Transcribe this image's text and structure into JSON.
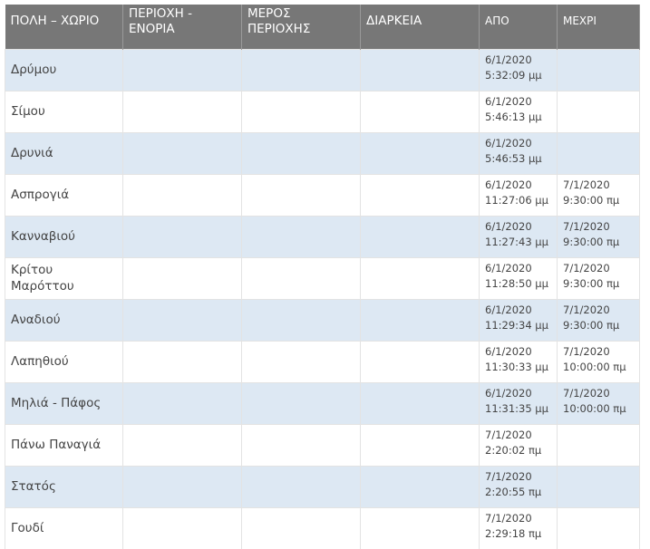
{
  "headers": {
    "place": "ΠΟΛΗ – ΧΩΡΙΟ",
    "region": "ΠΕΡΙΟΧΗ - ΕΝΟΡΙΑ",
    "part": "ΜΕΡΟΣ ΠΕΡΙΟΧΗΣ",
    "duration": "ΔΙΑΡΚΕΙΑ",
    "from": "ΑΠΟ",
    "to": "ΜΕΧΡΙ"
  },
  "rows": [
    {
      "place": "Δρύμου",
      "region": "",
      "part": "",
      "duration": "",
      "from_date": "6/1/2020",
      "from_time": "5:32:09 μμ",
      "to_date": "",
      "to_time": ""
    },
    {
      "place": "Σίμου",
      "region": "",
      "part": "",
      "duration": "",
      "from_date": "6/1/2020",
      "from_time": "5:46:13 μμ",
      "to_date": "",
      "to_time": ""
    },
    {
      "place": "Δρυνιά",
      "region": "",
      "part": "",
      "duration": "",
      "from_date": "6/1/2020",
      "from_time": "5:46:53 μμ",
      "to_date": "",
      "to_time": ""
    },
    {
      "place": "Ασπρογιά",
      "region": "",
      "part": "",
      "duration": "",
      "from_date": "6/1/2020",
      "from_time": "11:27:06 μμ",
      "to_date": "7/1/2020",
      "to_time": "9:30:00 πμ"
    },
    {
      "place": "Κανναβιού",
      "region": "",
      "part": "",
      "duration": "",
      "from_date": "6/1/2020",
      "from_time": "11:27:43 μμ",
      "to_date": "7/1/2020",
      "to_time": "9:30:00 πμ"
    },
    {
      "place": "Κρίτου Μαρόττου",
      "region": "",
      "part": "",
      "duration": "",
      "from_date": "6/1/2020",
      "from_time": "11:28:50 μμ",
      "to_date": "7/1/2020",
      "to_time": "9:30:00 πμ"
    },
    {
      "place": "Αναδιού",
      "region": "",
      "part": "",
      "duration": "",
      "from_date": "6/1/2020",
      "from_time": "11:29:34 μμ",
      "to_date": "7/1/2020",
      "to_time": "9:30:00 πμ"
    },
    {
      "place": "Λαπηθιού",
      "region": "",
      "part": "",
      "duration": "",
      "from_date": "6/1/2020",
      "from_time": "11:30:33 μμ",
      "to_date": "7/1/2020",
      "to_time": "10:00:00 πμ"
    },
    {
      "place": "Μηλιά - Πάφος",
      "region": "",
      "part": "",
      "duration": "",
      "from_date": "6/1/2020",
      "from_time": "11:31:35 μμ",
      "to_date": "7/1/2020",
      "to_time": "10:00:00 πμ"
    },
    {
      "place": "Πάνω Παναγιά",
      "region": "",
      "part": "",
      "duration": "",
      "from_date": "7/1/2020",
      "from_time": "2:20:02 πμ",
      "to_date": "",
      "to_time": ""
    },
    {
      "place": "Στατός",
      "region": "",
      "part": "",
      "duration": "",
      "from_date": "7/1/2020",
      "from_time": "2:20:55 πμ",
      "to_date": "",
      "to_time": ""
    },
    {
      "place": "Γουδί",
      "region": "",
      "part": "",
      "duration": "",
      "from_date": "7/1/2020",
      "from_time": "2:29:18 πμ",
      "to_date": "",
      "to_time": ""
    }
  ]
}
